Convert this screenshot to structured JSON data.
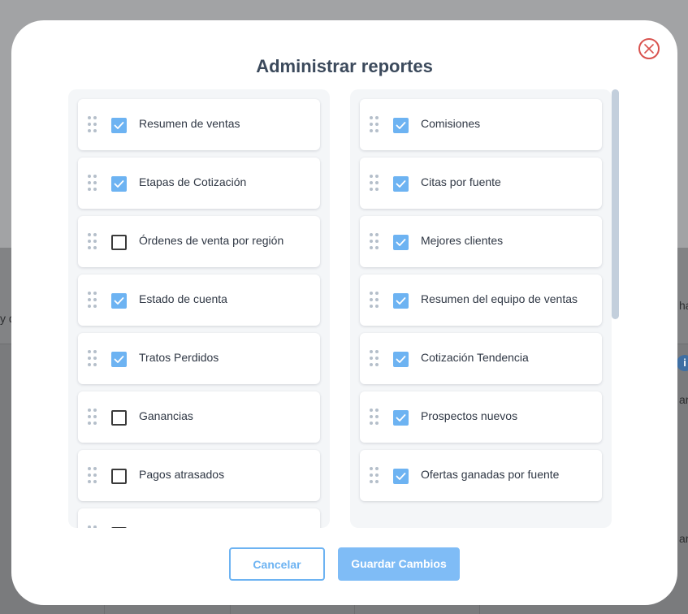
{
  "modal": {
    "title": "Administrar reportes",
    "left_column": [
      {
        "label": "Resumen de ventas",
        "checked": true
      },
      {
        "label": "Etapas de Cotización",
        "checked": true
      },
      {
        "label": "Órdenes de venta por región",
        "checked": false
      },
      {
        "label": "Estado de cuenta",
        "checked": true
      },
      {
        "label": "Tratos Perdidos",
        "checked": true
      },
      {
        "label": "Ganancias",
        "checked": false
      },
      {
        "label": "Pagos atrasados",
        "checked": false
      },
      {
        "label": "",
        "checked": false
      }
    ],
    "right_column": [
      {
        "label": "Comisiones",
        "checked": true
      },
      {
        "label": "Citas por fuente",
        "checked": true
      },
      {
        "label": "Mejores clientes",
        "checked": true
      },
      {
        "label": "Resumen del equipo de ventas",
        "checked": true
      },
      {
        "label": "Cotización Tendencia",
        "checked": true
      },
      {
        "label": "Prospectos nuevos",
        "checked": true
      },
      {
        "label": "Ofertas ganadas por fuente",
        "checked": true
      }
    ],
    "buttons": {
      "cancel": "Cancelar",
      "save": "Guardar Cambios"
    }
  },
  "background": {
    "fragments": [
      "y d",
      "ha",
      "ara",
      "ara"
    ],
    "info_icon": "i"
  },
  "colors": {
    "accent": "#6db3f2",
    "close": "#d9534f",
    "title": "#3c4a5c"
  }
}
